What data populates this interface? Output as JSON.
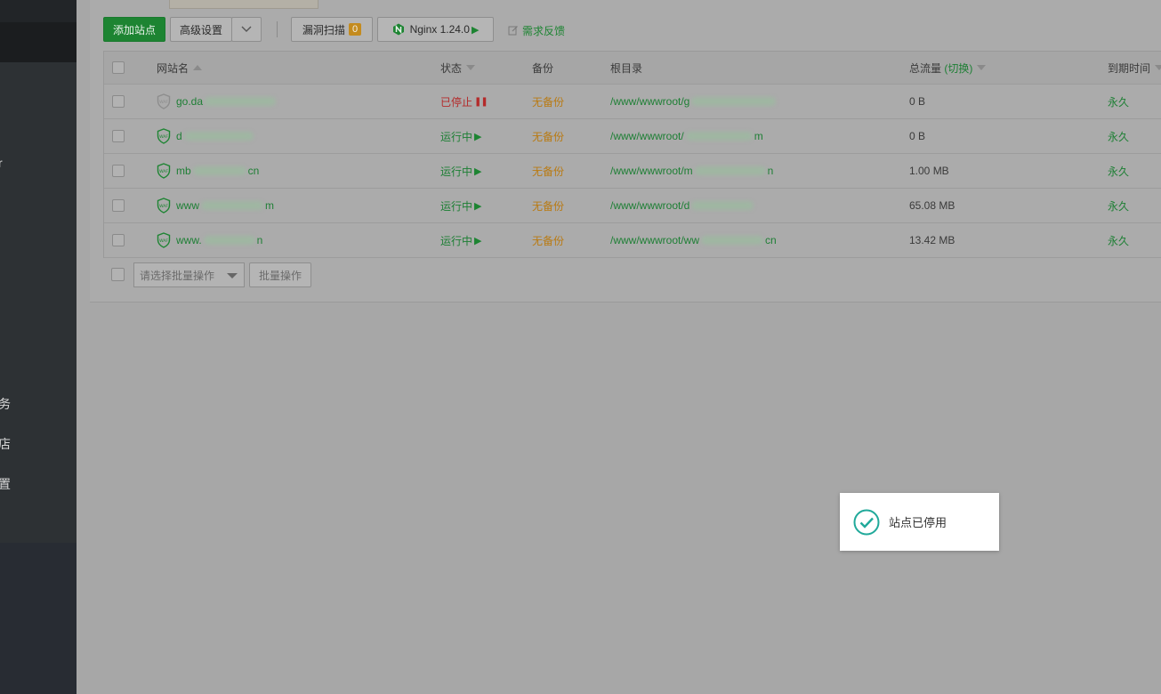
{
  "sidebar": {
    "fragments": [
      "r",
      "务",
      "店",
      "置"
    ]
  },
  "toolbar": {
    "add_site": "添加站点",
    "advanced": "高级设置",
    "scan": "漏洞扫描",
    "scan_count": "0",
    "nginx": "Nginx 1.24.0",
    "feedback": "需求反馈"
  },
  "table": {
    "headers": {
      "site": "网站名",
      "status": "状态",
      "backup": "备份",
      "root": "根目录",
      "traffic": "总流量",
      "switch": "(切换)",
      "expiry": "到期时间"
    },
    "rows": [
      {
        "name_prefix": "go.da",
        "name_suffix": "",
        "status": "已停止",
        "status_kind": "stopped",
        "backup": "无备份",
        "root_prefix": "/www/wwwroot/g",
        "root_suffix": "",
        "traffic": "0 B",
        "expiry": "永久"
      },
      {
        "name_prefix": "d",
        "name_suffix": "",
        "status": "运行中",
        "status_kind": "running",
        "backup": "无备份",
        "root_prefix": "/www/wwwroot/",
        "root_suffix": "m",
        "traffic": "0 B",
        "expiry": "永久"
      },
      {
        "name_prefix": "mb",
        "name_suffix": "cn",
        "status": "运行中",
        "status_kind": "running",
        "backup": "无备份",
        "root_prefix": "/www/wwwroot/m",
        "root_suffix": "n",
        "traffic": "1.00 MB",
        "expiry": "永久"
      },
      {
        "name_prefix": "www",
        "name_suffix": "m",
        "status": "运行中",
        "status_kind": "running",
        "backup": "无备份",
        "root_prefix": "/www/wwwroot/d",
        "root_suffix": "",
        "traffic": "65.08 MB",
        "expiry": "永久"
      },
      {
        "name_prefix": "www.",
        "name_suffix": "n",
        "status": "运行中",
        "status_kind": "running",
        "backup": "无备份",
        "root_prefix": "/www/wwwroot/ww",
        "root_suffix": "cn",
        "traffic": "13.42 MB",
        "expiry": "永久"
      }
    ]
  },
  "batch": {
    "placeholder": "请选择批量操作",
    "button": "批量操作"
  },
  "toast": {
    "message": "站点已停用"
  },
  "colors": {
    "accent_green": "#1d8432",
    "stopped_red": "#b42a2a",
    "no_backup_orange": "#b97a12",
    "badge_orange": "#c48b1e"
  },
  "icons": {
    "waf": "waf-shield-icon",
    "check": "check-circle-icon",
    "nginx": "nginx-hex-icon",
    "feedback": "edit-note-icon"
  }
}
